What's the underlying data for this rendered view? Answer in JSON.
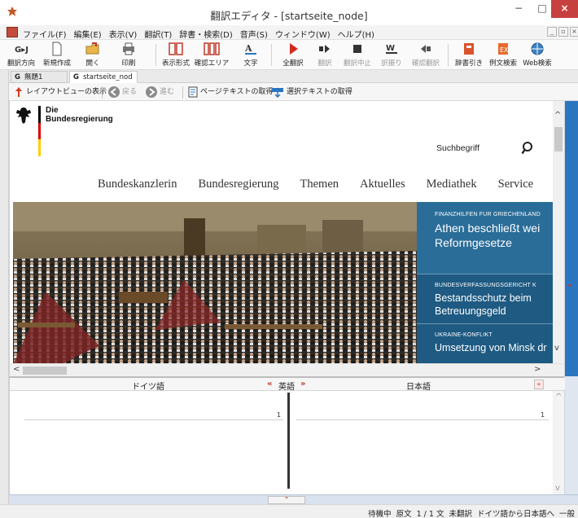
{
  "window": {
    "title": "翻訳エディタ - [startseite_node]",
    "min_label": "−",
    "max_label": "□",
    "close_label": "×"
  },
  "menu": {
    "items": [
      "ファイル(F)",
      "編集(E)",
      "表示(V)",
      "翻訳(T)",
      "辞書・検索(D)",
      "音声(S)",
      "ウィンドウ(W)",
      "ヘルプ(H)"
    ]
  },
  "toolbar": {
    "buttons": [
      {
        "label": "翻訳方向",
        "icon": "translation-direction-icon"
      },
      {
        "label": "新規作成",
        "icon": "new-document-icon"
      },
      {
        "label": "開く",
        "icon": "open-folder-icon"
      },
      {
        "label": "印刷",
        "icon": "printer-icon"
      },
      {
        "label": "表示形式",
        "icon": "display-format-icon"
      },
      {
        "label": "確認エリア",
        "icon": "confirm-area-icon"
      },
      {
        "label": "文字",
        "icon": "text-size-icon"
      },
      {
        "label": "全翻訳",
        "icon": "translate-all-icon"
      },
      {
        "label": "翻訳",
        "icon": "translate-icon"
      },
      {
        "label": "翻訳中止",
        "icon": "stop-translation-icon"
      },
      {
        "label": "訳振り",
        "icon": "interlinear-icon"
      },
      {
        "label": "確認翻訳",
        "icon": "back-translation-icon"
      },
      {
        "label": "辞書引き",
        "icon": "dictionary-icon"
      },
      {
        "label": "例文検索",
        "icon": "example-search-icon"
      },
      {
        "label": "Web検索",
        "icon": "web-search-icon"
      }
    ]
  },
  "tabs": [
    {
      "prefix": "G",
      "label": "無題1"
    },
    {
      "prefix": "G",
      "label": "startseite_nod"
    }
  ],
  "navbar": {
    "layout_view": "レイアウトビューの表示",
    "back": "戻る",
    "forward": "進む",
    "get_page_text": "ページテキストの取得",
    "get_selected_text": "選択テキストの取得"
  },
  "site": {
    "org_line1": "Die",
    "org_line2": "Bundesregierung",
    "search_placeholder": "Suchbegriff",
    "nav": [
      "Bundeskanzlerin",
      "Bundesregierung",
      "Themen",
      "Aktuelles",
      "Mediathek",
      "Service"
    ],
    "news": [
      {
        "kicker": "FINANZHILFEN FÜR GRIECHENLAND",
        "headline1": "Athen beschließt wei",
        "headline2": "Reformgesetze"
      },
      {
        "kicker": "BUNDESVERFASSUNGSGERICHT K",
        "headline1": "Bestandsschutz beim",
        "headline2": "Betreuungsgeld"
      },
      {
        "kicker": "UKRAINE-KONFLIKT",
        "headline1": "Umsetzung von Minsk dr",
        "headline2": ""
      }
    ]
  },
  "translation_panel": {
    "source_lang": "ドイツ語",
    "swap_left": "«",
    "middle_lang": "英語",
    "swap_right": "»",
    "target_lang": "日本語",
    "collapse_label": "«",
    "left_line_number": "1",
    "right_line_number": "1"
  },
  "splitter": {
    "knob_label": "⌃"
  },
  "status": {
    "state": "待機中",
    "source_text": "原文",
    "position": "1 / 1 文",
    "untranslated": "未翻訳",
    "direction": "ドイツ語から日本語へ",
    "mode": "一般"
  },
  "colors": {
    "brand_red": "#c34b3a",
    "news_blue": "#1e5a82",
    "accent_blue": "#2b75c0"
  }
}
